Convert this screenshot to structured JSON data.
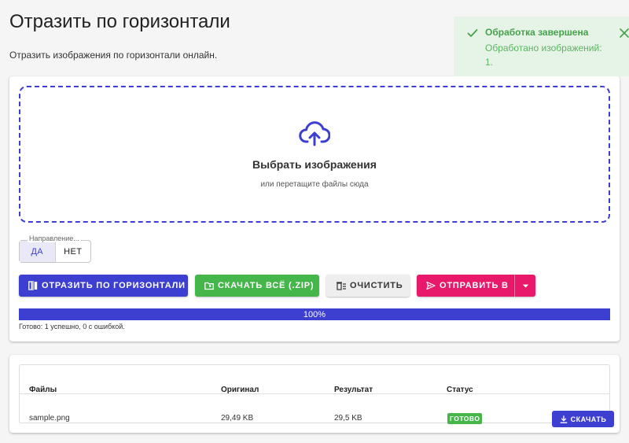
{
  "page": {
    "title": "Отразить по горизонтали",
    "subtitle": "Отразить изображения по горизонтали онлайн."
  },
  "dropzone": {
    "icon": "cloud-upload-icon",
    "title": "Выбрать изображения",
    "hint": "или перетащите файлы сюда"
  },
  "direction": {
    "legend": "Направление...",
    "options": [
      "ДА",
      "НЕТ"
    ],
    "selected": "ДА"
  },
  "actions": {
    "flip_label": "ОТРАЗИТЬ ПО ГОРИЗОНТАЛИ",
    "download_all_label": "СКАЧАТЬ ВСЁ (.ZIP)",
    "clear_label": "ОЧИСТИТЬ",
    "send_label": "ОТПРАВИТЬ В"
  },
  "progress": {
    "value": 100,
    "label": "100%",
    "status": "Готово: 1 успешно, 0 с ошибкой."
  },
  "files": {
    "headers": [
      "Файлы",
      "Оригинал",
      "Результат",
      "Статус"
    ],
    "rows": [
      {
        "name": "sample.png",
        "original": "29,49 KB",
        "result": "29,5 KB",
        "status": "ГОТОВО",
        "download_label": "СКАЧАТЬ"
      }
    ]
  },
  "toast": {
    "title": "Обработка завершена",
    "message": "Обработано изображений: 1."
  },
  "colors": {
    "primary": "#3d3fd0",
    "success": "#45b649",
    "danger": "#e8196b",
    "toast_bg": "#e6f3e7"
  }
}
